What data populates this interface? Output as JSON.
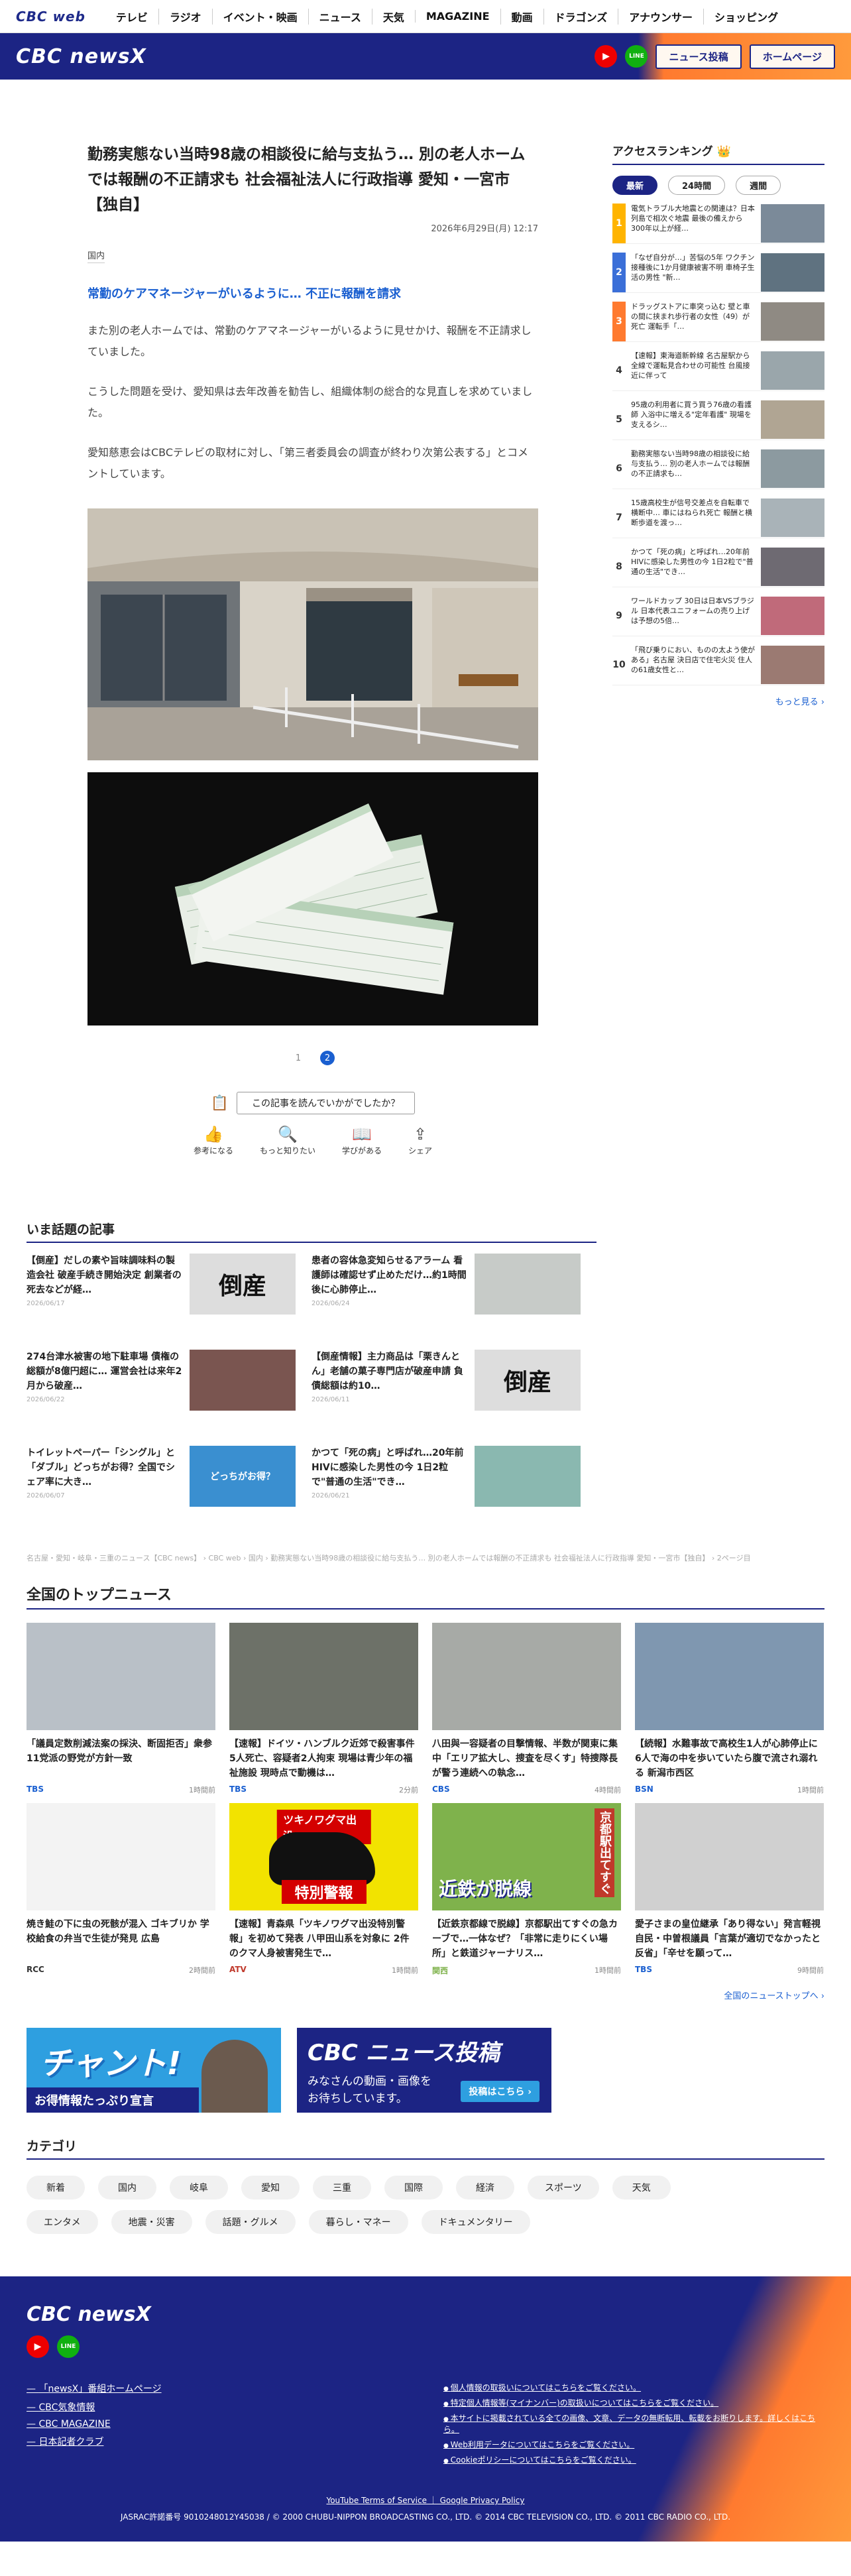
{
  "topnav": {
    "logo": "CBC web",
    "items": [
      "テレビ",
      "ラジオ",
      "イベント・映画",
      "ニュース",
      "天気",
      "MAGAZINE",
      "動画",
      "ドラゴンズ",
      "アナウンサー",
      "ショッピング"
    ]
  },
  "header": {
    "brand": "CBC newsX",
    "youtube": "▶",
    "line": "LINE",
    "post_button": "ニュース投稿",
    "home_button": "ホームページ"
  },
  "article": {
    "title": "勤務実態ない当時98歳の相談役に給与支払う… 別の老人ホームでは報酬の不正請求も 社会福祉法人に行政指導 愛知・一宮市【独自】",
    "date": "2026年6月29日(月) 12:17",
    "category": "国内",
    "subheading": "常勤のケアマネージャーがいるように… 不正に報酬を請求",
    "paragraphs": [
      "また別の老人ホームでは、常勤のケアマネージャーがいるように見せかけ、報酬を不正請求していました。",
      "こうした問題を受け、愛知県は去年改善を勧告し、組織体制の総合的な見直しを求めていました。",
      "愛知慈恵会はCBCテレビの取材に対し、「第三者委員会の調査が終わり次第公表する」とコメントしています。"
    ],
    "pages": [
      "1",
      "2"
    ],
    "survey_question": "この記事を読んでいかがでしたか？",
    "reactions": [
      {
        "icon": "👍",
        "label": "参考になる"
      },
      {
        "icon": "🔍",
        "label": "もっと知りたい"
      },
      {
        "icon": "📖",
        "label": "学びがある"
      },
      {
        "icon": "⇪",
        "label": "シェア"
      }
    ]
  },
  "sidebar": {
    "title": "アクセスランキング 👑",
    "tabs": [
      "最新",
      "24時間",
      "週間"
    ],
    "ranking": [
      {
        "num": "1",
        "text": "電気トラブル大地震との関連は？日本列島で相次ぐ地震 最後の備えから300年以上が経…"
      },
      {
        "num": "2",
        "text": "「なぜ自分が…」苦悩の5年 ワクチン接種後に1か月健康被害不明 車椅子生活の男性 \"新…"
      },
      {
        "num": "3",
        "text": "ドラッグストアに車突っ込む 壁と車の間に挟まれ歩行者の女性（49）が死亡 運転手「…"
      },
      {
        "num": "4",
        "text": "【速報】東海道新幹線 名古屋駅から全線で運転見合わせの可能性 台風接近に伴って"
      },
      {
        "num": "5",
        "text": "95歳の利用者に買う買う76歳の看護師 入浴中に増える\"定年看護\" 現場を支えるシ…"
      },
      {
        "num": "6",
        "text": "勤務実態ない当時98歳の相談役に給与支払う… 別の老人ホームでは報酬の不正請求も…"
      },
      {
        "num": "7",
        "text": "15歳高校生が信号交差点を自転車で横断中… 車にはねられ死亡 報酬と横断歩道を渡っ…"
      },
      {
        "num": "8",
        "text": "かつて「死の病」と呼ばれ…20年前HIVに感染した男性の今 1日2粒で\"普通の生活\"でき…"
      },
      {
        "num": "9",
        "text": "ワールドカップ 30日は日本VSブラジル 日本代表ユニフォームの売り上げは予想の5倍…"
      },
      {
        "num": "10",
        "text": "「飛び乗りにおい、ものの太よう使がある」名古屋 決日店で住宅火災 住人の61歳女性と…"
      }
    ],
    "more": "もっと見る ›"
  },
  "hot": {
    "title": "いま話題の記事",
    "items": [
      {
        "title": "【倒産】だしの素や旨味調味料の製造会社 破産手続き開始決定 創業者の死去などが経…",
        "date": "2026/06/17",
        "img": "倒産"
      },
      {
        "title": "患者の容体急変知らせるアラーム 看護師は確認せず止めただけ…約1時間後に心肺停止…",
        "date": "2026/06/24",
        "img": ""
      },
      {
        "title": "274台津水被害の地下駐車場 債権の総額が8億円超に… 運営会社は来年2月から破産…",
        "date": "2026/06/22",
        "img": ""
      },
      {
        "title": "【倒産情報】主力商品は「栗きんとん」老舗の菓子専門店が破産申請 負債総額は約10…",
        "date": "2026/06/11",
        "img": "倒産"
      },
      {
        "title": "トイレットペーパー「シングル」と「ダブル」どっちがお得？全国でシェア率に大き…",
        "date": "2026/06/07",
        "img": "どっちがお得？"
      },
      {
        "title": "かつて「死の病」と呼ばれ…20年前HIVに感染した男性の今 1日2粒で\"普通の生活\"でき…",
        "date": "2026/06/21",
        "img": ""
      }
    ]
  },
  "breadcrumb": "名古屋・愛知・岐阜・三重のニュース【CBC news】 › CBC web › 国内 › 勤務実態ない当時98歳の相談役に給与支払う… 別の老人ホームでは報酬の不正請求も 社会福祉法人に行政指導 愛知・一宮市【独自】 › 2ページ目",
  "topnews": {
    "title": "全国のトップニュース",
    "items": [
      {
        "title": "「議員定数削減法案の採決、断固拒否」衆参11党派の野党が方針一致",
        "src": "TBS",
        "time": "1時間前"
      },
      {
        "title": "【速報】ドイツ・ハンブルク近郊で殺害事件 5人死亡、容疑者2人拘束 現場は青少年の福祉施設 現時点で動機は…",
        "src": "TBS",
        "time": "2分前"
      },
      {
        "title": "八田與一容疑者の目撃情報、半数が関東に集中「エリア拡大し、捜査を尽くす」特捜隊長が警う連続への執念…",
        "src": "CBS",
        "time": "4時間前"
      },
      {
        "title": "【続報】水難事故で高校生1人が心肺停止に 6人で海の中を歩いていたら腹で流され溺れる 新潟市西区",
        "src": "BSN",
        "time": "1時間前"
      },
      {
        "title": "焼き鮭の下に虫の死骸が混入 ゴキブリか 学校給食の弁当で生徒が発見 広島",
        "src": "RCC",
        "time": "2時間前"
      },
      {
        "title": "【速報】青森県「ツキノワグマ出没特別警報」を初めて発表 八甲田山系を対象に 2件のクマ人身被害発生で…",
        "src": "ATV",
        "time": "1時間前"
      },
      {
        "title": "【近鉄京都線で脱線】京都駅出てすぐの急カーブで…一体なぜ？「非常に走りにくい場所」と鉄道ジャーナリス…",
        "src": "関西",
        "time": "1時間前"
      },
      {
        "title": "愛子さまの皇位継承「あり得ない」発言軽視 自民・中曽根議員「言葉が適切でなかったと反省」「辛せを願って…",
        "src": "TBS",
        "time": "9時間前"
      }
    ],
    "bear_caption": "ツキノワグマ出没",
    "bear_warning": "特別警報",
    "kyoto_text": "京都駅出てすぐ",
    "kintetsu_text": "近鉄が脱線",
    "all_link": "全国のニューストップへ ›"
  },
  "banners": {
    "chant_title": "チャント!",
    "chant_sub": "お得情報たっぷり宣言",
    "post_title": "CBC ニュース投稿",
    "post_sub1": "みなさんの動画・画像を",
    "post_sub2": "お待ちしています。",
    "post_btn": "投稿はこちら ›"
  },
  "categories": {
    "title": "カテゴリ",
    "items": [
      "新着",
      "国内",
      "岐阜",
      "愛知",
      "三重",
      "国際",
      "経済",
      "スポーツ",
      "天気",
      "エンタメ",
      "地震・災害",
      "話題・グルメ",
      "暮らし・マネー",
      "ドキュメンタリー"
    ]
  },
  "footer": {
    "brand": "CBC newsX",
    "links": [
      "「newsX」番組ホームページ",
      "CBC気象情報",
      "CBC MAGAZINE",
      "日本記者クラブ"
    ],
    "policies": [
      "個人情報の取扱いについてはこちらをご覧ください。",
      "特定個人情報等(マイナンバー)の取扱いについてはこちらをご覧ください。",
      "本サイトに掲載されている全ての画像、文章、データの無断転用、転載をお断りします。詳しくはこちら。",
      "Web利用データについてはこちらをご覧ください。",
      "Cookieポリシーについてはこちらをご覧ください。"
    ],
    "bottom_links": "YouTube Terms of Service ｜ Google Privacy Policy",
    "copyright": "JASRAC許諾番号 9010248012Y45038 / © 2000 CHUBU-NIPPON BROADCASTING CO., LTD. © 2014 CBC TELEVISION CO., LTD. © 2011 CBC RADIO CO., LTD."
  },
  "colors": {
    "navy": "#1c2484",
    "orange": "#ff7a2f",
    "link": "#1a5fd0"
  }
}
